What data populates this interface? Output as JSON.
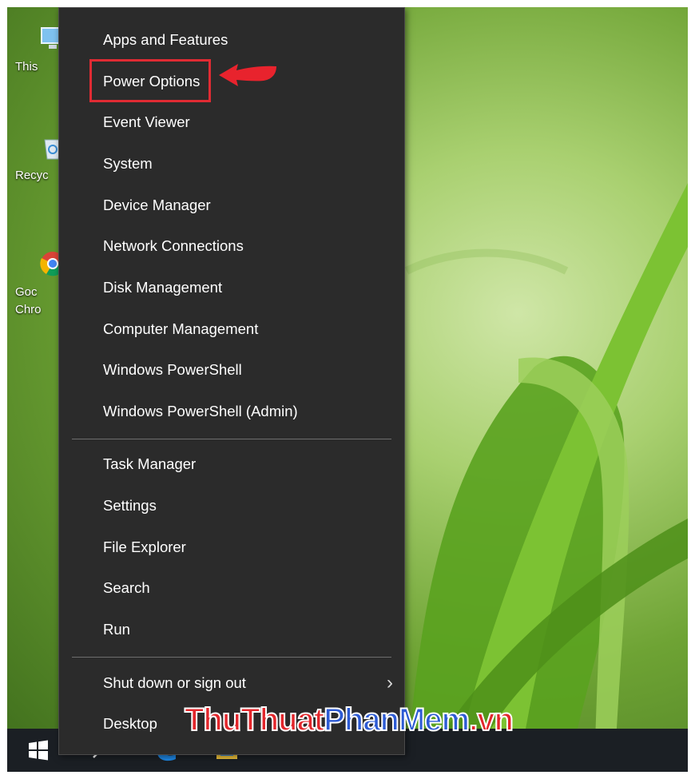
{
  "desktop_icons": [
    {
      "label": "This",
      "icon": "this-pc-icon"
    },
    {
      "label": "Recyc",
      "icon": "recycle-bin-icon"
    },
    {
      "label": "Goc",
      "label2": "Chro",
      "icon": "chrome-icon"
    }
  ],
  "menu": {
    "group1": [
      "Apps and Features",
      "Power Options",
      "Event Viewer",
      "System",
      "Device Manager",
      "Network Connections",
      "Disk Management",
      "Computer Management",
      "Windows PowerShell",
      "Windows PowerShell (Admin)"
    ],
    "group2": [
      "Task Manager",
      "Settings",
      "File Explorer",
      "Search",
      "Run"
    ],
    "group3": [
      {
        "label": "Shut down or sign out",
        "submenu_icon": "chevron-right-icon"
      },
      {
        "label": "Desktop"
      }
    ],
    "highlighted_item": "Power Options"
  },
  "watermark": {
    "part1": "ThuThuat",
    "part2": "PhanMem",
    "part3": ".vn"
  },
  "taskbar_icons": [
    "windows-start-icon",
    "search-icon",
    "edge-icon",
    "file-explorer-icon"
  ],
  "colors": {
    "menu_bg": "#2b2b2b",
    "highlight": "#e02b33",
    "watermark_red": "#e3262b",
    "watermark_blue": "#2d5bd4"
  }
}
